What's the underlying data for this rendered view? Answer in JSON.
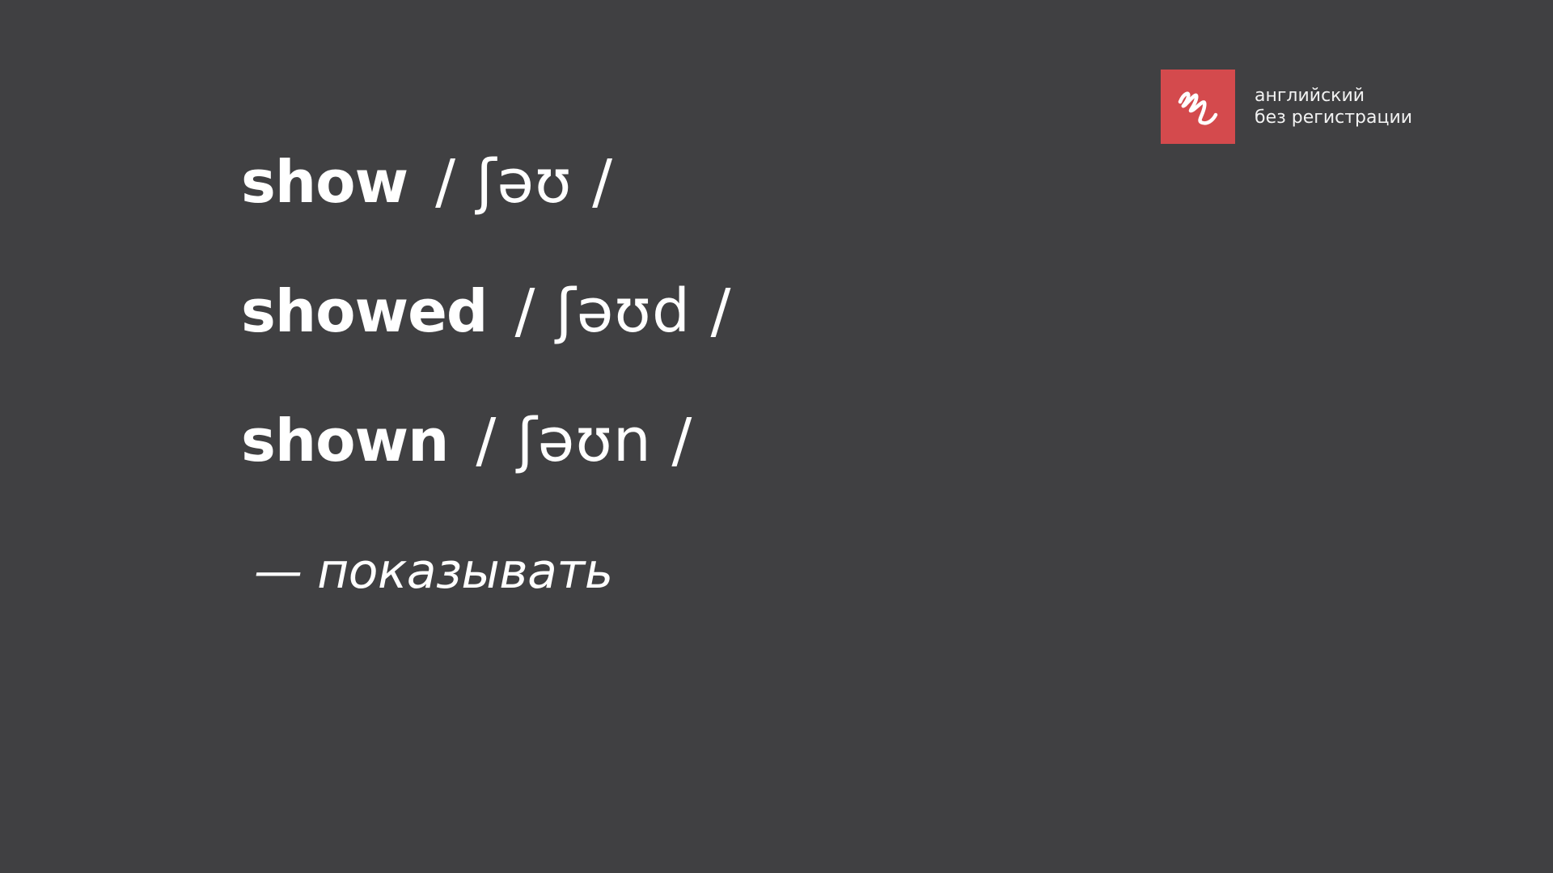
{
  "brand": {
    "line1": "английский",
    "line2": "без регистрации",
    "logo_color": "#d44a4d",
    "logo_icon": "squiggle-signature-icon"
  },
  "background_color": "#404042",
  "forms": [
    {
      "word": "show",
      "transcription": "/ ʃəʊ /"
    },
    {
      "word": "showed",
      "transcription": "/ ʃəʊd /"
    },
    {
      "word": "shown",
      "transcription": "/ ʃəʊn /"
    }
  ],
  "translation": "— показывать"
}
